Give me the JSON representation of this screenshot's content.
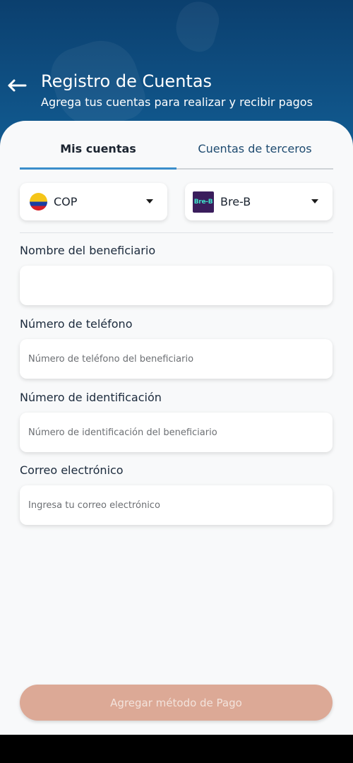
{
  "header": {
    "title": "Registro de Cuentas",
    "subtitle": "Agrega tus cuentas para realizar y recibir pagos",
    "back_icon": "arrow-left-icon"
  },
  "tabs": [
    {
      "label": "Mis cuentas",
      "active": true
    },
    {
      "label": "Cuentas de terceros",
      "active": false
    }
  ],
  "selectors": {
    "currency": {
      "value": "COP",
      "icon": "colombia-flag-icon"
    },
    "method": {
      "value": "Bre-B",
      "icon": "bre-b-logo",
      "logo_text": "Bre-B"
    }
  },
  "form": {
    "beneficiary_name": {
      "label": "Nombre del beneficiario",
      "value": "",
      "placeholder": ""
    },
    "phone": {
      "label": "Número de teléfono",
      "value": "",
      "placeholder": "Número de teléfono del beneficiario"
    },
    "identification": {
      "label": "Número de identificación",
      "value": "",
      "placeholder": "Número de identificación del beneficiario"
    },
    "email": {
      "label": "Correo electrónico",
      "value": "",
      "placeholder": "Ingresa tu correo electrónico"
    }
  },
  "submit_label": "Agregar método de Pago",
  "colors": {
    "header_bg": "#0f4a7b",
    "accent_tab": "#3b8ecb",
    "button_bg": "#dca996",
    "sheet_bg": "#f8f9fa"
  }
}
